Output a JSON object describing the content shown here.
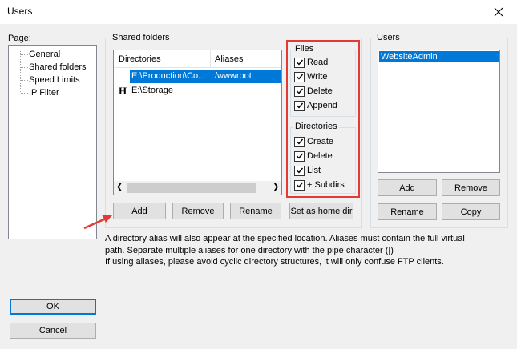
{
  "window": {
    "title": "Users"
  },
  "page_section": {
    "label": "Page:",
    "items": [
      "General",
      "Shared folders",
      "Speed Limits",
      "IP Filter"
    ],
    "selected_index": 1
  },
  "shared_folders": {
    "group_label": "Shared folders",
    "columns": [
      "Directories",
      "Aliases"
    ],
    "rows": [
      {
        "marker": "",
        "directory": "E:\\Production\\Co...",
        "alias": "/wwwroot",
        "selected": true
      },
      {
        "marker": "H",
        "directory": "E:\\Storage",
        "alias": "",
        "selected": false
      }
    ],
    "buttons": {
      "add": "Add",
      "remove": "Remove",
      "rename": "Rename",
      "home_dir": "Set as home dir"
    }
  },
  "files_perms": {
    "label": "Files",
    "items": [
      {
        "label": "Read",
        "checked": true
      },
      {
        "label": "Write",
        "checked": true
      },
      {
        "label": "Delete",
        "checked": true
      },
      {
        "label": "Append",
        "checked": true
      }
    ]
  },
  "dirs_perms": {
    "label": "Directories",
    "items": [
      {
        "label": "Create",
        "checked": true
      },
      {
        "label": "Delete",
        "checked": true
      },
      {
        "label": "List",
        "checked": true
      },
      {
        "label": "+ Subdirs",
        "checked": true
      }
    ]
  },
  "users": {
    "group_label": "Users",
    "list": [
      "WebsiteAdmin"
    ],
    "buttons": {
      "add": "Add",
      "remove": "Remove",
      "rename": "Rename",
      "copy": "Copy"
    }
  },
  "help_text": {
    "line1": "A directory alias will also appear at the specified location. Aliases must contain the full virtual",
    "line2": "path. Separate multiple aliases for one directory with the pipe character (|)",
    "line3": "If using aliases, please avoid cyclic directory structures, it will only confuse FTP clients."
  },
  "dialog_buttons": {
    "ok": "OK",
    "cancel": "Cancel"
  },
  "colors": {
    "selection": "#0078d7",
    "annotation_red": "#e53935",
    "window_bg": "#f0f0f0"
  }
}
